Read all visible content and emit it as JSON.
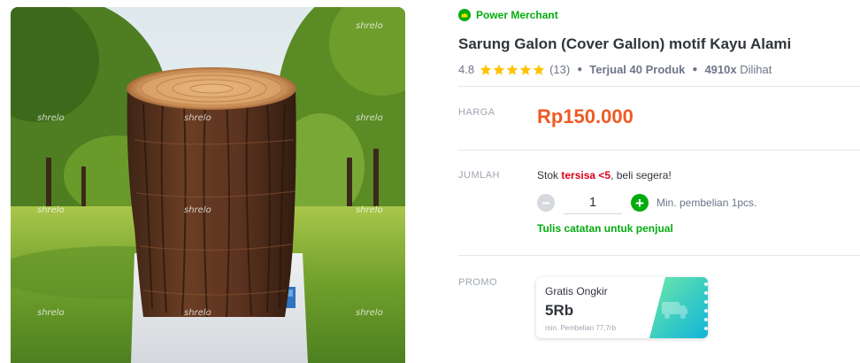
{
  "badge": {
    "label": "Power Merchant",
    "icon": "power-merchant-icon",
    "color": "#03ac0e"
  },
  "product": {
    "title": "Sarung Galon (Cover Gallon) motif Kayu Alami",
    "rating": "4.8",
    "stars": 5,
    "review_count": "(13)",
    "sold_label": "Terjual 40 Produk",
    "views_value": "4910x",
    "views_label": "Dilihat",
    "image_watermark": "shrelo"
  },
  "price": {
    "label": "HARGA",
    "value": "Rp150.000",
    "color": "#ef5a24"
  },
  "quantity": {
    "label": "JUMLAH",
    "stock_prefix": "Stok",
    "stock_highlight": "tersisa <5",
    "stock_suffix": ", beli segera!",
    "value": "1",
    "min_purchase": "Min. pembelian 1pcs.",
    "note_link": "Tulis catatan untuk penjual"
  },
  "promo": {
    "label": "PROMO",
    "coupon_name": "Gratis Ongkir",
    "coupon_value": "5Rb",
    "coupon_min": "min. Pembelian 77,7rb",
    "coupon_icon": "truck-icon"
  }
}
